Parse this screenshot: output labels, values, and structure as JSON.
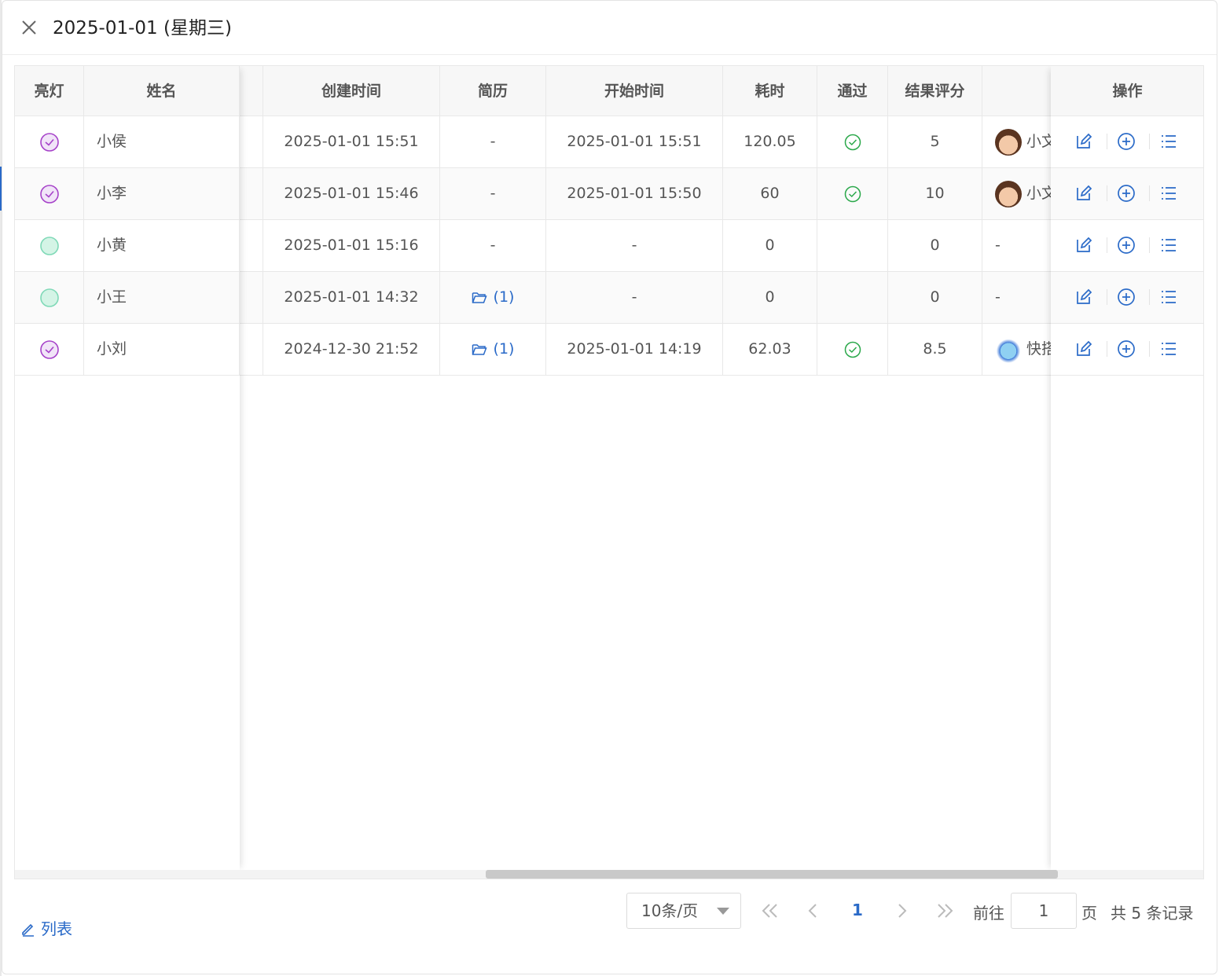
{
  "dialog": {
    "title": "2025-01-01 (星期三)"
  },
  "table": {
    "columns": {
      "light": "亮灯",
      "name": "姓名",
      "created": "创建时间",
      "resume": "简历",
      "start": "开始时间",
      "duration": "耗时",
      "passed": "通过",
      "score": "结果评分",
      "assignee": "",
      "actions": "操作"
    },
    "rows": [
      {
        "status": "done",
        "name": "小侯",
        "created": "2025-01-01 15:51",
        "resume": "-",
        "start": "2025-01-01 15:51",
        "duration": "120.05",
        "passed": true,
        "score": "5",
        "assignee": "小文",
        "avatar": "boy-avatar"
      },
      {
        "status": "done",
        "name": "小李",
        "created": "2025-01-01 15:46",
        "resume": "-",
        "start": "2025-01-01 15:50",
        "duration": "60",
        "passed": true,
        "score": "10",
        "assignee": "小文",
        "avatar": "boy-avatar"
      },
      {
        "status": "pending",
        "name": "小黄",
        "created": "2025-01-01 15:16",
        "resume": "-",
        "start": "-",
        "duration": "0",
        "passed": false,
        "score": "0",
        "assignee": "-",
        "avatar": ""
      },
      {
        "status": "pending",
        "name": "小王",
        "created": "2025-01-01 14:32",
        "resume": "(1)",
        "start": "-",
        "duration": "0",
        "passed": false,
        "score": "0",
        "assignee": "-",
        "avatar": ""
      },
      {
        "status": "done",
        "name": "小刘",
        "created": "2024-12-30 21:52",
        "resume": "(1)",
        "start": "2025-01-01 14:19",
        "duration": "62.03",
        "passed": true,
        "score": "8.5",
        "assignee": "快搭",
        "avatar": "cloud-avatar"
      }
    ]
  },
  "footer": {
    "list_link": "列表",
    "page_size": "10条/页",
    "current_page": "1",
    "goto_label": "前往",
    "goto_value": "1",
    "page_suffix": "页",
    "total": "共 5 条记录"
  },
  "colors": {
    "accent": "#2a6ac8",
    "status_done": "#a642c9",
    "status_pending": "#7fd9b7",
    "pass_green": "#2aa84a"
  }
}
